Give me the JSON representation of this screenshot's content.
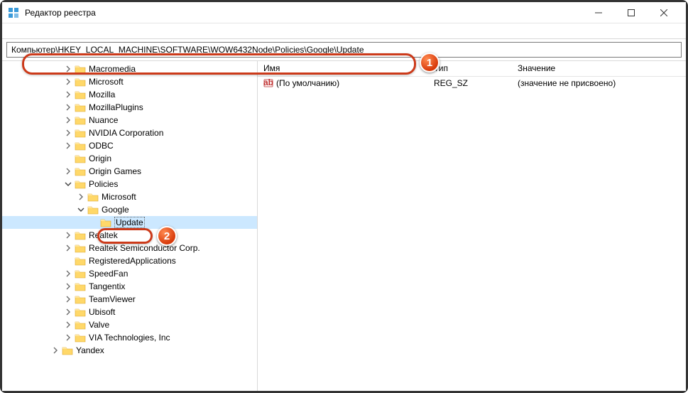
{
  "window": {
    "title": "Редактор реестра"
  },
  "address": {
    "path": "Компьютер\\HKEY_LOCAL_MACHINE\\SOFTWARE\\WOW6432Node\\Policies\\Google\\Update"
  },
  "tree": {
    "items": [
      {
        "label": "Macromedia",
        "level": 0,
        "exp": "closed"
      },
      {
        "label": "Microsoft",
        "level": 0,
        "exp": "closed"
      },
      {
        "label": "Mozilla",
        "level": 0,
        "exp": "closed"
      },
      {
        "label": "MozillaPlugins",
        "level": 0,
        "exp": "closed"
      },
      {
        "label": "Nuance",
        "level": 0,
        "exp": "closed"
      },
      {
        "label": "NVIDIA Corporation",
        "level": 0,
        "exp": "closed"
      },
      {
        "label": "ODBC",
        "level": 0,
        "exp": "closed"
      },
      {
        "label": "Origin",
        "level": 0,
        "exp": "none"
      },
      {
        "label": "Origin Games",
        "level": 0,
        "exp": "closed"
      },
      {
        "label": "Policies",
        "level": 0,
        "exp": "open"
      },
      {
        "label": "Microsoft",
        "level": 1,
        "exp": "closed"
      },
      {
        "label": "Google",
        "level": 1,
        "exp": "open"
      },
      {
        "label": "Update",
        "level": 2,
        "exp": "none",
        "selected": true
      },
      {
        "label": "Realtek",
        "level": 0,
        "exp": "closed"
      },
      {
        "label": "Realtek Semiconductor Corp.",
        "level": 0,
        "exp": "closed"
      },
      {
        "label": "RegisteredApplications",
        "level": 0,
        "exp": "none"
      },
      {
        "label": "SpeedFan",
        "level": 0,
        "exp": "closed"
      },
      {
        "label": "Tangentix",
        "level": 0,
        "exp": "closed"
      },
      {
        "label": "TeamViewer",
        "level": 0,
        "exp": "closed"
      },
      {
        "label": "Ubisoft",
        "level": 0,
        "exp": "closed"
      },
      {
        "label": "Valve",
        "level": 0,
        "exp": "closed"
      },
      {
        "label": "VIA Technologies, Inc",
        "level": 0,
        "exp": "closed"
      }
    ],
    "yandex": {
      "label": "Yandex",
      "exp": "closed"
    }
  },
  "list": {
    "columns": {
      "name": "Имя",
      "type": "Тип",
      "value": "Значение"
    },
    "rows": [
      {
        "name": "(По умолчанию)",
        "type": "REG_SZ",
        "value": "(значение не присвоено)"
      }
    ]
  },
  "callouts": {
    "one": "1",
    "two": "2"
  }
}
